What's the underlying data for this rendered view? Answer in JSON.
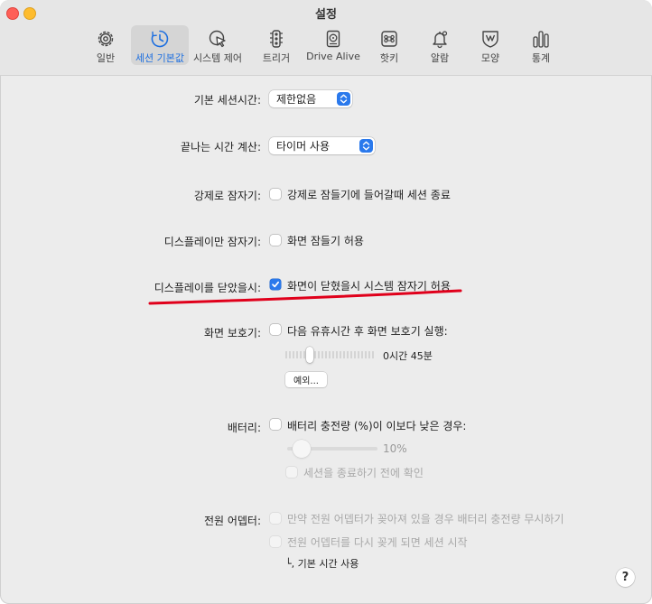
{
  "window": {
    "title": "설정"
  },
  "toolbar": {
    "tabs": [
      {
        "label": "일반",
        "icon": "gear-icon"
      },
      {
        "label": "세션 기본값",
        "icon": "clock-icon",
        "selected": true
      },
      {
        "label": "시스템 제어",
        "icon": "cursor-icon"
      },
      {
        "label": "트리거",
        "icon": "traffic-light-icon"
      },
      {
        "label": "Drive Alive",
        "icon": "drive-icon"
      },
      {
        "label": "핫키",
        "icon": "command-key-icon"
      },
      {
        "label": "알람",
        "icon": "bell-icon"
      },
      {
        "label": "모양",
        "icon": "shield-icon"
      },
      {
        "label": "통계",
        "icon": "bar-chart-icon"
      }
    ]
  },
  "settings": {
    "default_session": {
      "label": "기본 세션시간:",
      "value": "제한없음"
    },
    "end_time_calc": {
      "label": "끝나는 시간 계산:",
      "value": "타이머 사용"
    },
    "force_sleep": {
      "label": "강제로 잠자기:",
      "checkbox": "강제로 잠들기에 들어갈때 세션 종료",
      "checked": false
    },
    "display_sleep": {
      "label": "디스플레이만 잠자기:",
      "checkbox": "화면 잠들기 허용",
      "checked": false
    },
    "lid_closed": {
      "label": "디스플레이를 닫았을시:",
      "checkbox": "화면이 닫혔을시 시스템 잠자기 허용",
      "checked": true
    },
    "screensaver": {
      "label": "화면 보호기:",
      "checkbox": "다음 유휴시간 후 화면 보호기 실행:",
      "checked": false,
      "slider_value": "0시간 45분",
      "slider_fraction": 0.25,
      "example_button": "예외..."
    },
    "battery": {
      "label": "배터리:",
      "checkbox": "배터리 충전량 (%)이 이보다 낮은 경우:",
      "checked": false,
      "slider_value": "10%",
      "slider_fraction": 0.08,
      "sub_checkbox": "세션을 종료하기 전에 확인"
    },
    "power_adapter": {
      "label": "전원 어뎁터:",
      "checkbox1": "만약 전원 어뎁터가 꽂아져 있을 경우 배터리 충전량 무시하기",
      "checkbox2": "전원 어뎁터를 다시 꽂게 되면 세션 시작",
      "sub_note": "└, 기본 시간 사용"
    }
  },
  "help": {
    "label": "?"
  },
  "colors": {
    "accent": "#2a79ec",
    "annotation": "#e0001b"
  }
}
